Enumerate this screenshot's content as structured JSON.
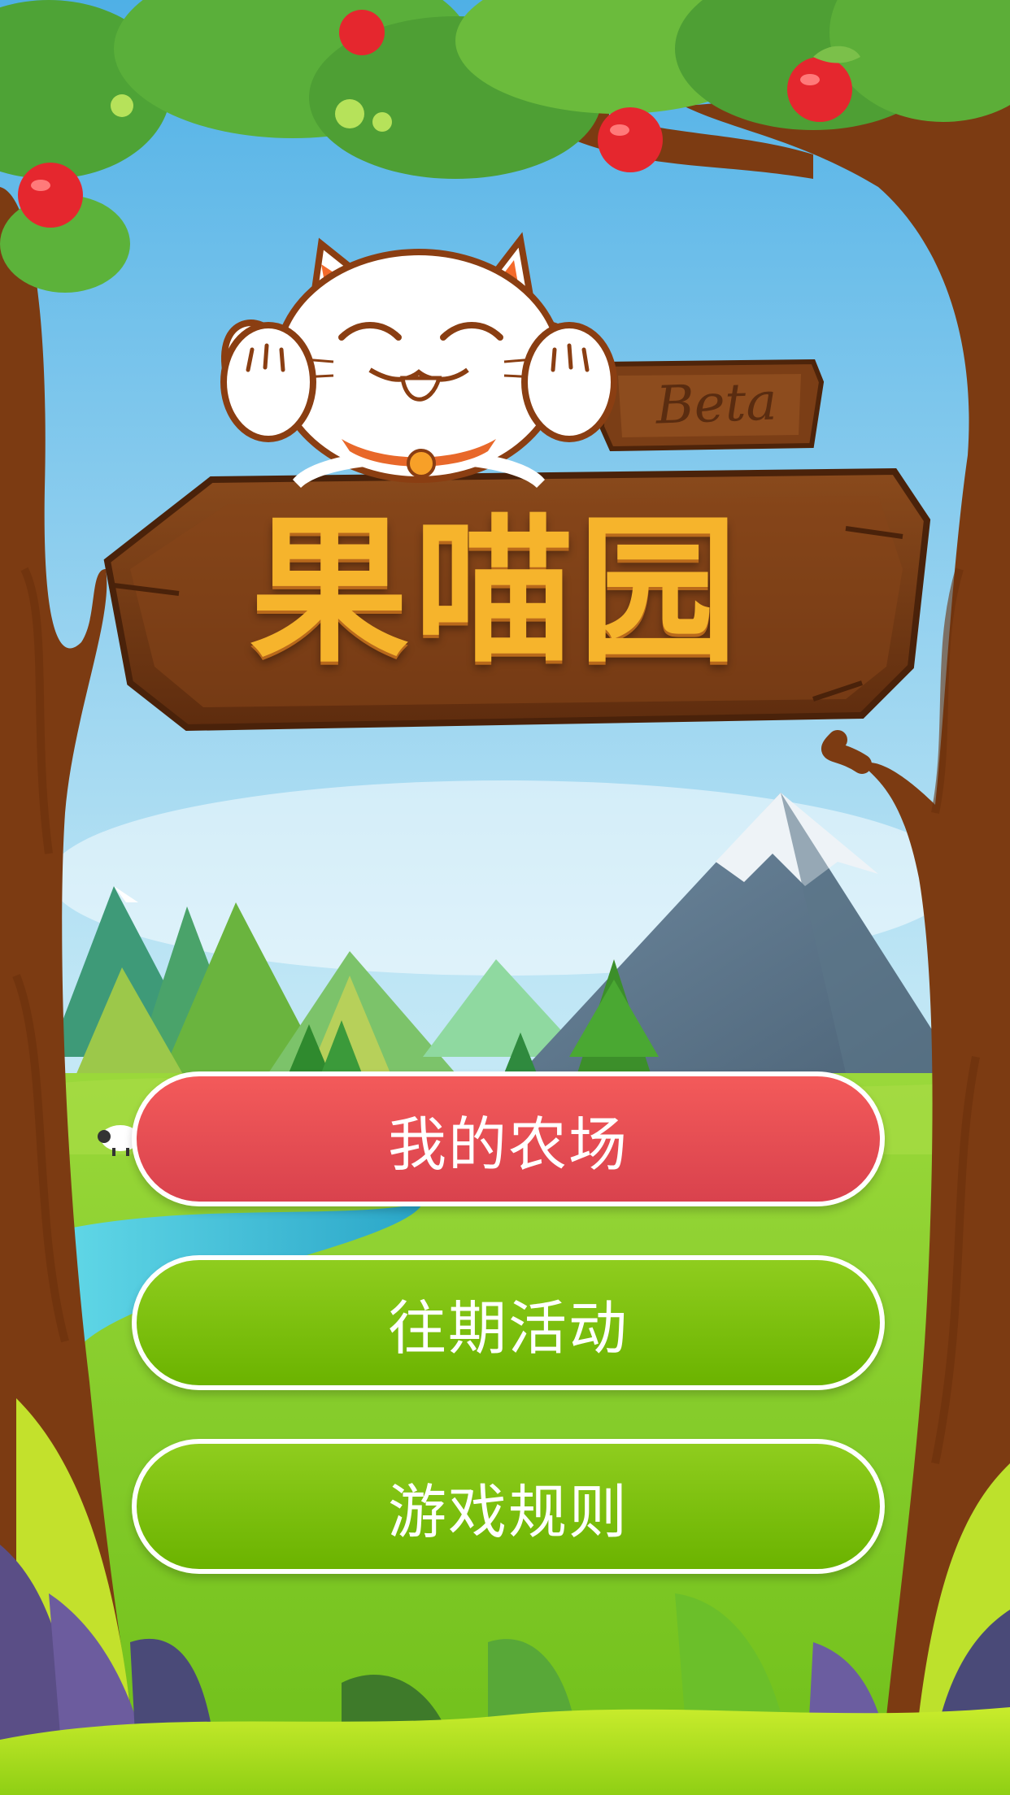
{
  "logo": {
    "title": "果喵园",
    "badge": "Beta"
  },
  "menu": {
    "my_farm": "我的农场",
    "past_events": "往期活动",
    "game_rules": "游戏规则"
  },
  "colors": {
    "sky_top": "#4fb0e6",
    "sky_bottom": "#e6f6fb",
    "grass": "#8ccf2a",
    "trunk": "#7c3b12",
    "sign_wood": "#7a3f16",
    "logo_text": "#f6b42c",
    "button_red": "#e84d55",
    "button_green": "#7ec10c"
  }
}
